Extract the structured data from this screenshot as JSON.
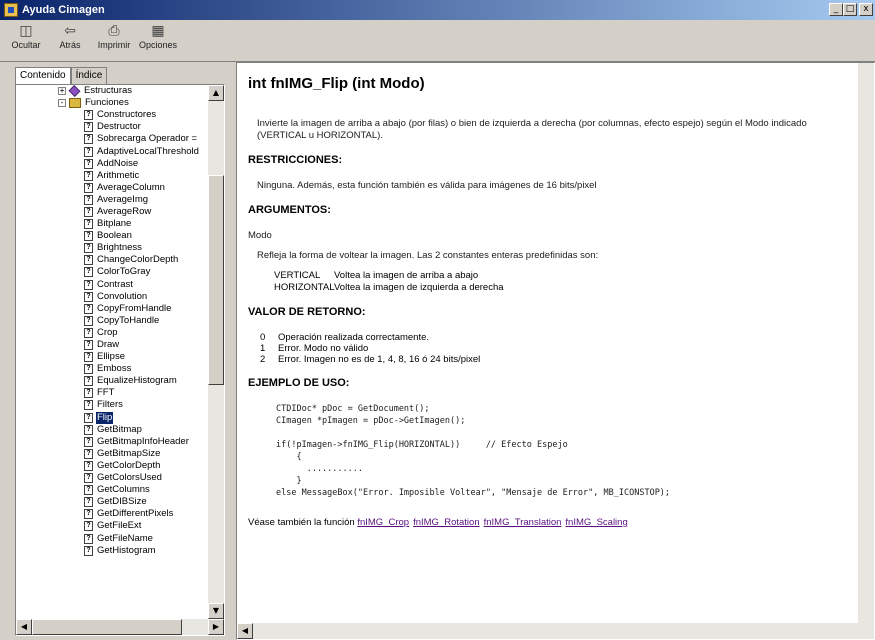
{
  "window": {
    "title": "Ayuda Cimagen",
    "buttons": [
      "_",
      "□",
      "x"
    ]
  },
  "toolbar": {
    "buttons": [
      {
        "label": "Ocultar",
        "icon": "hide-icon"
      },
      {
        "label": "Atrás",
        "icon": "back-arrow-icon"
      },
      {
        "label": "Imprimir",
        "icon": "print-icon"
      },
      {
        "label": "Opciones",
        "icon": "options-icon"
      }
    ]
  },
  "left_panel": {
    "tabs": [
      {
        "label": "Contenido",
        "active": true
      },
      {
        "label": "Índice",
        "active": false
      }
    ],
    "tree": [
      {
        "label": "Estructuras",
        "type": "book",
        "level": 1,
        "expander": "+"
      },
      {
        "label": "Funciones",
        "type": "folder",
        "level": 1,
        "expander": "-"
      },
      {
        "label": "Constructores",
        "type": "page",
        "level": 2
      },
      {
        "label": "Destructor",
        "type": "page",
        "level": 2
      },
      {
        "label": "Sobrecarga Operador =",
        "type": "page",
        "level": 2
      },
      {
        "label": "AdaptiveLocalThreshold",
        "type": "page",
        "level": 2
      },
      {
        "label": "AddNoise",
        "type": "page",
        "level": 2
      },
      {
        "label": "Arithmetic",
        "type": "page",
        "level": 2
      },
      {
        "label": "AverageColumn",
        "type": "page",
        "level": 2
      },
      {
        "label": "AverageImg",
        "type": "page",
        "level": 2
      },
      {
        "label": "AverageRow",
        "type": "page",
        "level": 2
      },
      {
        "label": "Bitplane",
        "type": "page",
        "level": 2
      },
      {
        "label": "Boolean",
        "type": "page",
        "level": 2
      },
      {
        "label": "Brightness",
        "type": "page",
        "level": 2
      },
      {
        "label": "ChangeColorDepth",
        "type": "page",
        "level": 2
      },
      {
        "label": "ColorToGray",
        "type": "page",
        "level": 2
      },
      {
        "label": "Contrast",
        "type": "page",
        "level": 2
      },
      {
        "label": "Convolution",
        "type": "page",
        "level": 2
      },
      {
        "label": "CopyFromHandle",
        "type": "page",
        "level": 2
      },
      {
        "label": "CopyToHandle",
        "type": "page",
        "level": 2
      },
      {
        "label": "Crop",
        "type": "page",
        "level": 2
      },
      {
        "label": "Draw",
        "type": "page",
        "level": 2
      },
      {
        "label": "Ellipse",
        "type": "page",
        "level": 2
      },
      {
        "label": "Emboss",
        "type": "page",
        "level": 2
      },
      {
        "label": "EqualizeHistogram",
        "type": "page",
        "level": 2
      },
      {
        "label": "FFT",
        "type": "page",
        "level": 2
      },
      {
        "label": "Filters",
        "type": "page",
        "level": 2
      },
      {
        "label": "Flip",
        "type": "page",
        "level": 2,
        "selected": true
      },
      {
        "label": "GetBitmap",
        "type": "page",
        "level": 2
      },
      {
        "label": "GetBitmapInfoHeader",
        "type": "page",
        "level": 2
      },
      {
        "label": "GetBitmapSize",
        "type": "page",
        "level": 2
      },
      {
        "label": "GetColorDepth",
        "type": "page",
        "level": 2
      },
      {
        "label": "GetColorsUsed",
        "type": "page",
        "level": 2
      },
      {
        "label": "GetColumns",
        "type": "page",
        "level": 2
      },
      {
        "label": "GetDIBSize",
        "type": "page",
        "level": 2
      },
      {
        "label": "GetDifferentPixels",
        "type": "page",
        "level": 2
      },
      {
        "label": "GetFileExt",
        "type": "page",
        "level": 2
      },
      {
        "label": "GetFileName",
        "type": "page",
        "level": 2
      },
      {
        "label": "GetHistogram",
        "type": "page",
        "level": 2
      }
    ]
  },
  "content": {
    "title": "int fnIMG_Flip (int Modo)",
    "description": "Invierte la imagen de arriba a abajo (por filas) o bien de izquierda a derecha (por columnas, efecto espejo) según el Modo indicado (VERTICAL u HORIZONTAL).",
    "restrictions_heading": "RESTRICCIONES:",
    "restrictions_text": "Ninguna. Además, esta función también es válida para imágenes de 16 bits/pixel",
    "arguments_heading": "ARGUMENTOS:",
    "argument_name": "Modo",
    "argument_text": "Refleja la forma de voltear la imagen. Las 2 constantes enteras predefinidas son:",
    "constants": [
      {
        "name": "VERTICAL",
        "desc": "Voltea la imagen de arriba a abajo"
      },
      {
        "name": "HORIZONTAL",
        "desc": "Voltea la imagen de izquierda a derecha"
      }
    ],
    "return_heading": "VALOR DE RETORNO:",
    "return_values": [
      {
        "code": "0",
        "desc": "Operación realizada correctamente."
      },
      {
        "code": "1",
        "desc": "Error. Modo no válido"
      },
      {
        "code": "2",
        "desc": "Error. Imagen no es de 1, 4, 8, 16 ó 24 bits/pixel"
      }
    ],
    "example_heading": "EJEMPLO DE USO:",
    "code": "CTDIDoc* pDoc = GetDocument();\nCImagen *pImagen = pDoc->GetImagen();\n\nif(!pImagen->fnIMG_Flip(HORIZONTAL))     // Efecto Espejo\n    {\n      ...........\n    }\nelse MessageBox(\"Error. Imposible Voltear\", \"Mensaje de Error\", MB_ICONSTOP);",
    "see_also_prefix": "Véase también la función",
    "see_also_links": [
      "fnIMG_Crop",
      "fnIMG_Rotation",
      "fnIMG_Translation",
      "fnIMG_Scaling"
    ]
  }
}
